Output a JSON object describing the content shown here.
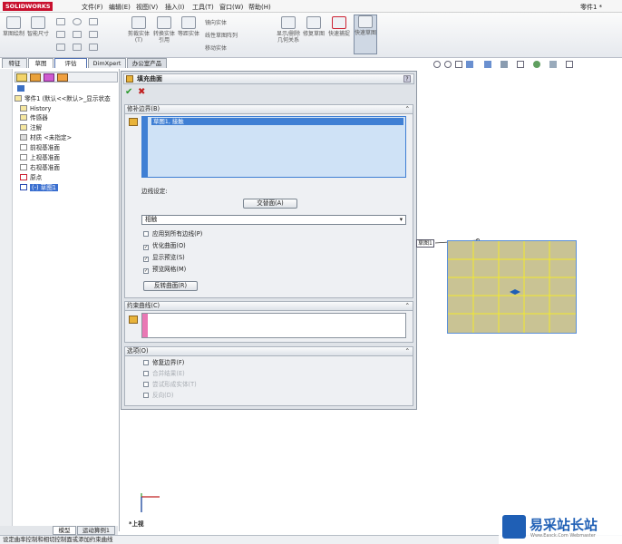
{
  "titlebar": {
    "logo": "SOLIDWORKS",
    "menu": [
      "文件(F)",
      "编辑(E)",
      "视图(V)",
      "插入(I)",
      "工具(T)",
      "窗口(W)",
      "帮助(H)"
    ],
    "doc_title": "零件1 *"
  },
  "ribbon": {
    "buttons": [
      "草图绘制",
      "智能尺寸",
      "剪裁实体(T)",
      "转换实体引用",
      "等距实体",
      "镜向实体",
      "线性草图阵列",
      "移动实体",
      "显示/删除几何关系",
      "修复草图",
      "快速捕捉",
      "快速草图"
    ]
  },
  "tabs": [
    "特征",
    "草图",
    "评估",
    "DimXpert",
    "办公室产品"
  ],
  "tree": {
    "root": "零件1 (默认<<默认>_显示状态",
    "items": [
      "History",
      "传感器",
      "注解",
      "材质 <未指定>",
      "前视基准面",
      "上视基准面",
      "右视基准面",
      "原点",
      "(-) 草图1"
    ]
  },
  "property_manager": {
    "title": "填充曲面",
    "ok": "✔",
    "cancel": "✖",
    "patch_section": "修补边界(B)",
    "patch_item": "草图1, 接触",
    "edge_settings_label": "边线设定:",
    "alt_face_button": "交替面(A)",
    "contact_select": "相触",
    "apply_all_edges": "应用到所有边线(P)",
    "optimize": "优化曲面(O)",
    "show_preview": "显示预览(S)",
    "preview_mesh": "预览网格(M)",
    "reverse_button": "反转曲面(R)",
    "constraint_section": "约束曲线(C)",
    "options_section": "选项(O)",
    "fix_boundary": "修复边界(F)",
    "merge_result": "合并结果(E)",
    "try_solid": "尝试形成实体(T)",
    "reverse_dir": "反向(D)"
  },
  "canvas": {
    "sketch_label": "草图1",
    "view_label": "*上视"
  },
  "bottom_tabs": [
    "模型",
    "运动算例1"
  ],
  "status": "设定曲率控制和相切控制面或添加约束曲线",
  "watermark": {
    "text": "易采站长站",
    "sub": "Www.Easck.Com Webmaster"
  },
  "colors": {
    "accent": "#1f5fb5",
    "patch_fill": "#c9c394",
    "grid_line": "#f2ea2c"
  }
}
